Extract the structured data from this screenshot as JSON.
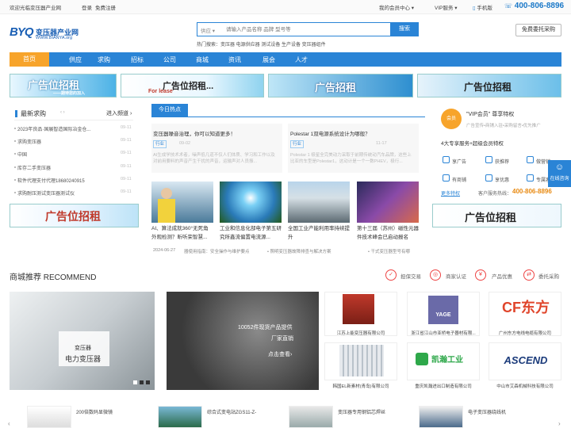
{
  "topbar": {
    "welcome": "欢迎光临变压器产业网",
    "login": "登录",
    "register": "免费注册",
    "member_center": "我的会员中心 ▾",
    "vip_service": "VIP服务 ▾",
    "mobile": "手机版",
    "hotline": "400-806-8896"
  },
  "logo": {
    "mark": "BYQ",
    "name": "变压器产业网",
    "url": "WWW.BIANYA.org"
  },
  "search": {
    "category": "供应",
    "placeholder": "请输入产品名称 品牌 型号等",
    "button": "搜索",
    "hot_label": "热门搜索：变压器 电源供应器 测试设备 生产设备 变压器组件"
  },
  "entrust": "免费委托采购",
  "nav": [
    "首页",
    "供应",
    "求购",
    "招标",
    "公司",
    "商城",
    "资讯",
    "展会",
    "人才"
  ],
  "banners": [
    {
      "main": "广告位招租",
      "sub": "——期待您的加入"
    },
    {
      "main": "广告位招租...",
      "sub": "For lease"
    },
    {
      "main": "广告招租",
      "sub": ""
    },
    {
      "main": "广告位招租",
      "sub": ""
    }
  ],
  "latest_buy": {
    "title": "最新求购",
    "more": "进入频道 ›",
    "items": [
      {
        "text": "2023年良品·国展智造国际冶金仓...",
        "date": "09-11"
      },
      {
        "text": "求购变压器",
        "date": "09-11"
      },
      {
        "text": "中国",
        "date": "09-11"
      },
      {
        "text": "库存二手变压器",
        "date": "09-11"
      },
      {
        "text": "软件代理支付代理18680240915",
        "date": "09-11"
      },
      {
        "text": "求购耐压测试变压器测试仪",
        "date": "09-11"
      }
    ]
  },
  "left_banner": "广告位招租",
  "today_hot": {
    "tab": "今日热点",
    "news": [
      {
        "title": "变压器噪音治理，你可以知道更多！",
        "tag": "行业",
        "date": "09-02",
        "desc": "AI生成学技术术者，噪声低几道不仅人们体质、学习和工作以及对前用要料的声音产生干扰的声音，运输声对人员振..."
      },
      {
        "title": "Polestar 1双电源系统设计为哪般？",
        "tag": "行业",
        "date": "11-17",
        "desc": "Polestar 1 极星全完美动力采取于前期传统动汽车品牌，这些上比亚的车型是Polestar1，这动计是一个一数PHEV，极行..."
      }
    ],
    "thumbs": [
      "AI、算法成就360°无死角外观检测？昕听荣智慧...",
      "工业和信息化部电子第五研究所鑫流偏置电流源...",
      "全国工业产能利用率持续提升",
      "第十三届（苏州）磁性元器件技术峰会已启动报名"
    ],
    "ticker": [
      {
        "date": "2024-06-27",
        "text": "器使用指南：安全操作与维护要点"
      },
      {
        "text": "照明变压器故障排查与解决方案"
      },
      {
        "text": "干式变压器型号有哪"
      }
    ]
  },
  "vip": {
    "badge": "会员",
    "title": "\"VIP会员\" 尊享特权",
    "subtitle": "广告宣传•商铺入驻•采购留言•优先推广",
    "service_line": "4大专享服务+超级会员特权",
    "services": [
      "享广告",
      "获推荐",
      "做营销",
      "有商铺",
      "享优惠",
      "专属客服"
    ],
    "more": "更多特权",
    "phone_label": "客户服务热线：",
    "phone": "400-806-8896"
  },
  "right_banner": "广告位招租",
  "recommend": {
    "title": "商城推荐 RECOMMEND",
    "badges": [
      "担保交易",
      "商家认证",
      "产品优惠",
      "委托采购"
    ],
    "left_card": {
      "cat": "变压器",
      "title": "电力变压器"
    },
    "center_card": {
      "line1": "10052件现货产品提供",
      "line2": "厂家直销",
      "line3": "点击查看›"
    },
    "companies": [
      {
        "name": "江苏上能变压器有限公司",
        "logo": ""
      },
      {
        "name": "浙江省江山市亚桥电子器材有限...",
        "logo": "YAGE"
      },
      {
        "name": "广州东方电线电缆有限公司",
        "logo": "东方"
      },
      {
        "name": "韩国EL新素材(青岛)有限公司",
        "logo": ""
      },
      {
        "name": "重庆凯瀚进出口制造有限公司",
        "logo": "凯瀚工业"
      },
      {
        "name": "中山市艾森机械科技有限公司",
        "logo": "ASCEND"
      }
    ]
  },
  "bottom_items": [
    "200倍数码显微镜",
    "综合式变电站ZGS11-Z-",
    "变压器专用钢铝芯焊丝",
    "电子变压器绕线机"
  ],
  "chat": "在线咨询",
  "colors": {
    "primary": "#2a84d6",
    "accent": "#f7a42b",
    "price": "#e88a12"
  }
}
